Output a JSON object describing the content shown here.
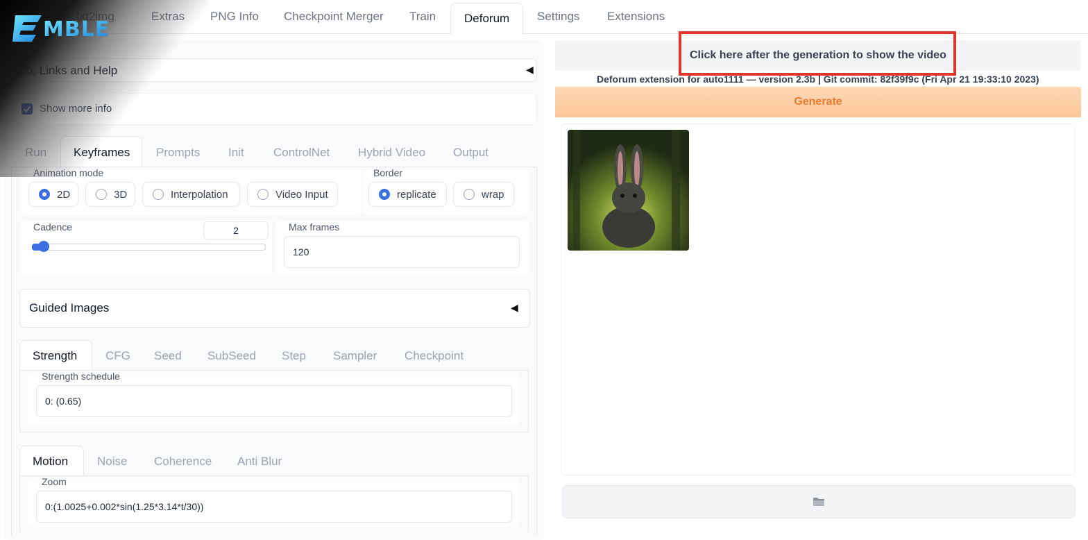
{
  "top_tabs": [
    "txt2img",
    "Extras",
    "PNG Info",
    "Checkpoint Merger",
    "Train",
    "Deforum",
    "Settings",
    "Extensions"
  ],
  "logo_text": "EMBLE",
  "info_section": {
    "title": "Info, Links and Help",
    "show_more_label": "Show more info",
    "show_more_checked": true
  },
  "main_tabs": [
    "Run",
    "Keyframes",
    "Prompts",
    "Init",
    "ControlNet",
    "Hybrid Video",
    "Output"
  ],
  "animation_mode": {
    "label": "Animation mode",
    "options": [
      "2D",
      "3D",
      "Interpolation",
      "Video Input"
    ],
    "selected": "2D"
  },
  "border": {
    "label": "Border",
    "options": [
      "replicate",
      "wrap"
    ],
    "selected": "replicate"
  },
  "cadence": {
    "label": "Cadence",
    "value": "2",
    "slider_fraction": 0.04
  },
  "max_frames": {
    "label": "Max frames",
    "value": "120"
  },
  "guided_images": {
    "title": "Guided Images"
  },
  "schedule_tabs": [
    "Strength",
    "CFG",
    "Seed",
    "SubSeed",
    "Step",
    "Sampler",
    "Checkpoint"
  ],
  "strength": {
    "label": "Strength schedule",
    "value": "0: (0.65)"
  },
  "motion_tabs": [
    "Motion",
    "Noise",
    "Coherence",
    "Anti Blur"
  ],
  "zoom": {
    "label": "Zoom",
    "value": "0:(1.0025+0.002*sin(1.25*3.14*t/30))"
  },
  "right": {
    "video_button": "Click here after the generation to show the video",
    "version_text": "Deforum extension for auto1111 — version 2.3b | Git commit: 82f39f9c (Fri Apr 21 19:33:10 2023)",
    "generate_label": "Generate"
  },
  "colors": {
    "accent": "#3b6fe0",
    "highlight": "#e0362c",
    "generate": "#ea7b2e"
  },
  "icons": {
    "collapse": "triangle-left-icon",
    "folder": "folder-icon"
  }
}
